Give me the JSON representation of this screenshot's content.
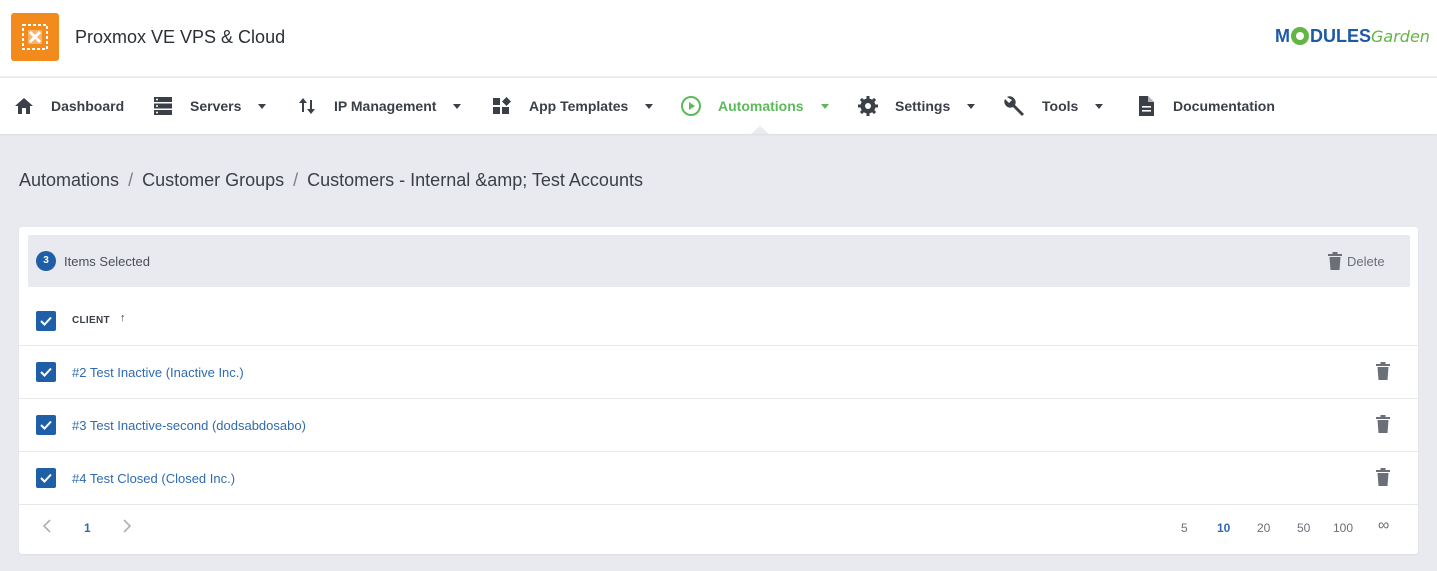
{
  "header": {
    "title": "Proxmox VE VPS & Cloud",
    "brand_prefix": "M",
    "brand_mid": "DULES",
    "brand_suffix": "Garden",
    "accent_color": "#f28a1c",
    "brand_color": "#1d5aa6",
    "brand_green": "#64b544"
  },
  "nav": {
    "items": [
      {
        "label": "Dashboard",
        "icon": "home-icon",
        "dropdown": false
      },
      {
        "label": "Servers",
        "icon": "servers-icon",
        "dropdown": true
      },
      {
        "label": "IP Management",
        "icon": "sort-arrows-icon",
        "dropdown": true
      },
      {
        "label": "App Templates",
        "icon": "widgets-icon",
        "dropdown": true
      },
      {
        "label": "Automations",
        "icon": "play-circle-icon",
        "dropdown": true,
        "active": true
      },
      {
        "label": "Settings",
        "icon": "gear-icon",
        "dropdown": true
      },
      {
        "label": "Tools",
        "icon": "wrench-icon",
        "dropdown": true
      },
      {
        "label": "Documentation",
        "icon": "document-icon",
        "dropdown": false
      }
    ],
    "active_color": "#5cba5a"
  },
  "breadcrumb": {
    "items": [
      "Automations",
      "Customer Groups",
      "Customers - Internal &amp; Test Accounts"
    ],
    "separator": "/"
  },
  "selection": {
    "count": "3",
    "label": "Items Selected",
    "delete_label": "Delete"
  },
  "table": {
    "column_header": "CLIENT",
    "sort_indicator": "↑",
    "rows": [
      {
        "client": "#2 Test Inactive (Inactive Inc.)",
        "checked": true
      },
      {
        "client": "#3 Test Inactive-second (dodsabdosabo)",
        "checked": true
      },
      {
        "client": "#4 Test Closed (Closed Inc.)",
        "checked": true
      }
    ]
  },
  "pagination": {
    "current_page": "1",
    "page_sizes": [
      "5",
      "10",
      "20",
      "50",
      "100",
      "∞"
    ],
    "selected_page_size": "10"
  },
  "colors": {
    "checkbox": "#1e5fa8",
    "link": "#2f6bb0",
    "page_bg": "#e9eaef"
  }
}
